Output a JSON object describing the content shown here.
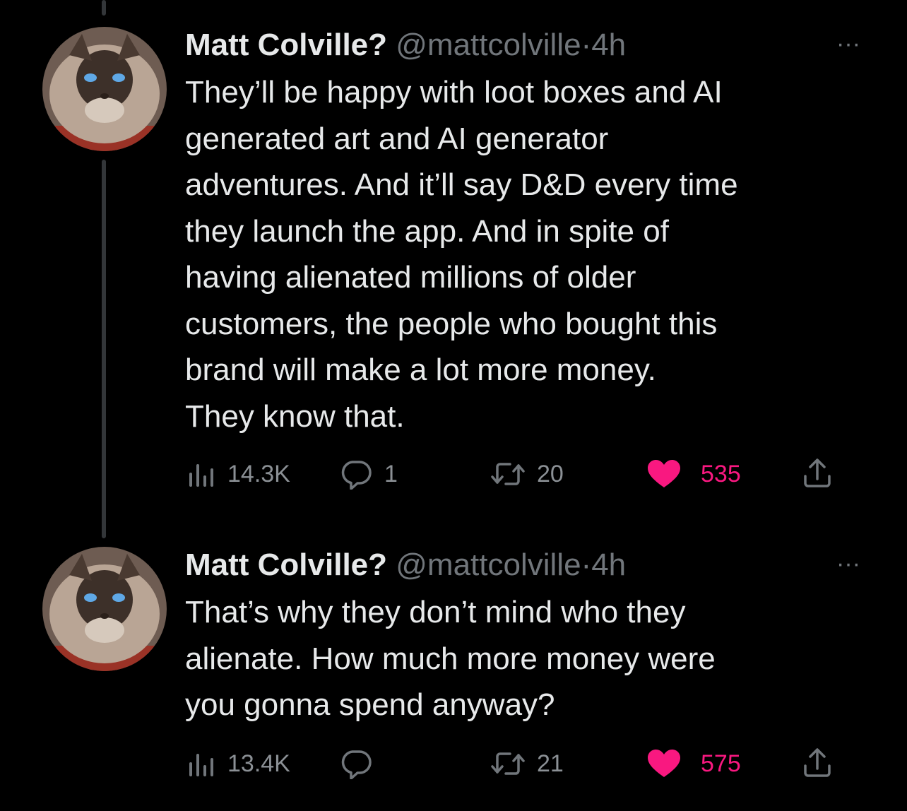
{
  "tweets": [
    {
      "author_name": "Matt Colville?",
      "author_handle": "@mattcolville",
      "dot": "·",
      "timestamp": "4h",
      "more": "···",
      "text_lines": [
        "They’ll be happy with loot boxes and AI",
        "generated art and AI generator",
        "adventures. And it’ll say D&D every time",
        "they launch the app. And in spite of",
        "having alienated millions of older",
        "customers, the people who bought this",
        "brand will make a lot more money.",
        "They know that."
      ],
      "views": "14.3K",
      "replies": "1",
      "retweets": "20",
      "likes": "535"
    },
    {
      "author_name": "Matt Colville?",
      "author_handle": "@mattcolville",
      "dot": "·",
      "timestamp": "4h",
      "more": "···",
      "text_lines": [
        "That’s why they don’t mind who they",
        "alienate. How much more money were",
        "you gonna spend anyway?"
      ],
      "views": "13.4K",
      "replies": "",
      "retweets": "21",
      "likes": "575"
    }
  ],
  "colors": {
    "background": "#000000",
    "text": "#e7e9ea",
    "secondary": "#71767b",
    "like": "#f91880",
    "thread_line": "#333639"
  },
  "icons": [
    "views-icon",
    "reply-icon",
    "retweet-icon",
    "heart-icon",
    "share-icon",
    "more-icon"
  ]
}
